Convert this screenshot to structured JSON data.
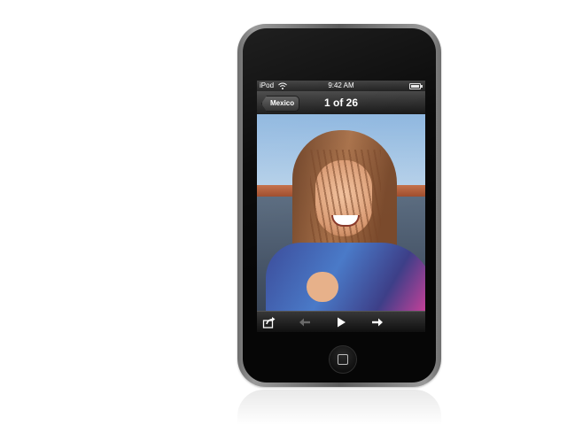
{
  "device": {
    "status_bar": {
      "carrier": "iPod",
      "time": "9:42 AM",
      "wifi_icon": "wifi-icon",
      "battery_icon": "battery-icon"
    },
    "nav_bar": {
      "back_label": "Mexico",
      "title": "1 of 26"
    },
    "toolbar": {
      "items": [
        "share-icon",
        "previous-arrow-icon",
        "play-icon",
        "next-arrow-icon"
      ]
    },
    "photo_subject": "photo-woman-smiling",
    "home_button_icon": "home-square-icon"
  },
  "colors": {
    "bar_text": "#ffffff",
    "bezel": "#060606",
    "frame": "#8a8a8a"
  }
}
